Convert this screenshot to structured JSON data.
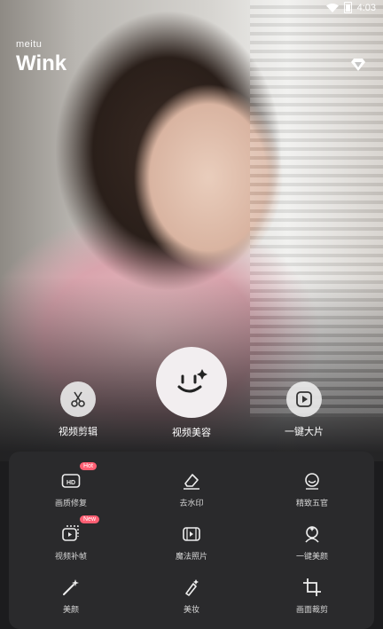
{
  "status_bar": {
    "time": "4:03",
    "battery_label": "8"
  },
  "brand": {
    "small": "meitu",
    "name": "Wink"
  },
  "actions": [
    {
      "label": "视频剪辑",
      "icon": "scissors-icon"
    },
    {
      "label": "视频美容",
      "icon": "smile-sparkle-icon"
    },
    {
      "label": "一键大片",
      "icon": "play-icon"
    }
  ],
  "tools": [
    {
      "label": "画质修复",
      "icon": "hd-icon",
      "badge": "Hot"
    },
    {
      "label": "去水印",
      "icon": "eraser-icon",
      "badge": ""
    },
    {
      "label": "精致五官",
      "icon": "face-icon",
      "badge": ""
    },
    {
      "label": "视频补帧",
      "icon": "frames-icon",
      "badge": "New"
    },
    {
      "label": "魔法照片",
      "icon": "film-icon",
      "badge": ""
    },
    {
      "label": "一键美颜",
      "icon": "portrait-icon",
      "badge": ""
    },
    {
      "label": "美颜",
      "icon": "magic-wand-icon",
      "badge": ""
    },
    {
      "label": "美妆",
      "icon": "makeup-brush-icon",
      "badge": ""
    },
    {
      "label": "画面裁剪",
      "icon": "crop-icon",
      "badge": ""
    }
  ],
  "colors": {
    "panel": "#2a2a2c",
    "badge": "#ff5f73",
    "background": "#1c1c1e"
  }
}
